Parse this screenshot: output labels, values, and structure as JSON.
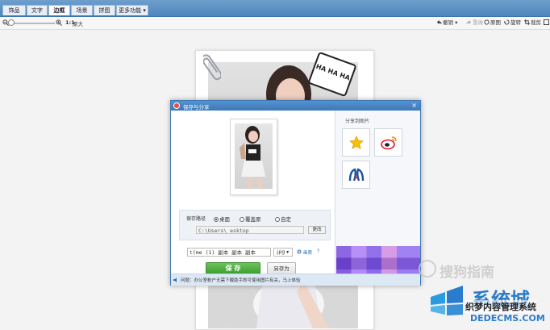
{
  "tabs": [
    {
      "label": "饰品"
    },
    {
      "label": "文字"
    },
    {
      "label": "边框"
    },
    {
      "label": "场景"
    },
    {
      "label": "拼图"
    },
    {
      "label": "更多功能 ▾"
    }
  ],
  "toolbar": {
    "zoom_ratio": "1:1",
    "zoom_label": "原大",
    "undo": "撤销",
    "redo": "重做",
    "original": "原图",
    "rotate": "旋转",
    "crop": "裁剪",
    "resize": "尺寸"
  },
  "canvas": {
    "tag_text": "HA HA HA"
  },
  "dialog": {
    "title": "保存与分享",
    "close": "×",
    "path_label": "保存路径",
    "radio_desktop": "桌面",
    "radio_overwrite": "覆盖原",
    "radio_custom": "自定",
    "path_value": "C:\\Users\\          esktop",
    "change_button": "更改",
    "filename": "t(me (1) 副本 副本 副本",
    "format": ".jpg",
    "settings_link": "画质",
    "help": "?",
    "save_button": "保 存",
    "saveas_button": "另存为",
    "share_title": "分享到图片",
    "status_text": "问题：办公室帐户无需下载助手即可使用图片有关，马上体验"
  },
  "watermarks": {
    "sougou": "搜狗指南",
    "xitong": "系统城",
    "dede_cn": "织梦内容管理系统",
    "dede_en": "DEDECMS.COM"
  },
  "colors": {
    "accent": "#4e86bd",
    "save_green": "#4caf3d",
    "watermark_blue": "#2b7ccc"
  }
}
